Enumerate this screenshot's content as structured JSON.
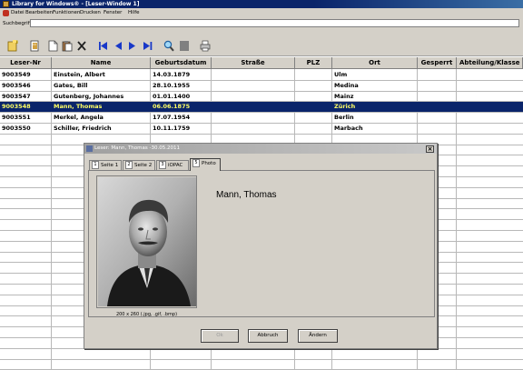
{
  "window": {
    "title": "Library for Windows® - [Leser-Window 1]"
  },
  "menu": {
    "items": [
      "Datei",
      "Bearbeiten",
      "Funktionen",
      "Drucken",
      "Fenster",
      "Hilfe"
    ]
  },
  "search": {
    "label": "Suchbegriff",
    "value": "",
    "placeholder": ""
  },
  "toolbar": {
    "buttons": [
      "new-icon",
      "copy-icon",
      "page-icon",
      "paste-icon",
      "delete-icon",
      "first-record-icon",
      "prev-record-icon",
      "next-record-icon",
      "last-record-icon",
      "search-icon",
      "stop-icon",
      "print-icon"
    ]
  },
  "grid": {
    "columns": [
      "Leser-Nr",
      "Name",
      "Geburtsdatum",
      "Straße",
      "PLZ",
      "Ort",
      "Gesperrt",
      "Abteilung/Klasse"
    ],
    "rows": [
      [
        "9003549",
        "Einstein, Albert",
        "14.03.1879",
        "",
        "",
        "Ulm",
        "",
        ""
      ],
      [
        "9003546",
        "Gates, Bill",
        "28.10.1955",
        "",
        "",
        "Medina",
        "",
        ""
      ],
      [
        "9003547",
        "Gutenberg, Johannes",
        "01.01.1400",
        "",
        "",
        "Mainz",
        "",
        ""
      ],
      [
        "9003548",
        "Mann, Thomas",
        "06.06.1875",
        "",
        "",
        "Zürich",
        "",
        ""
      ],
      [
        "9003551",
        "Merkel, Angela",
        "17.07.1954",
        "",
        "",
        "Berlin",
        "",
        ""
      ],
      [
        "9003550",
        "Schiller, Friedrich",
        "10.11.1759",
        "",
        "",
        "Marbach",
        "",
        ""
      ]
    ],
    "selected_row": 3
  },
  "dialog": {
    "title": "Leser: Mann, Thomas -30.05.2011",
    "close_label": "×",
    "tabs": [
      {
        "num": "1",
        "label": "Seite 1"
      },
      {
        "num": "2",
        "label": "Seite 2"
      },
      {
        "num": "3",
        "label": "iOPAC"
      },
      {
        "num": "5",
        "label": "Photo"
      }
    ],
    "active_tab": 3,
    "person_name": "Mann, Thomas",
    "photo_caption": "200 x 260 (.jpg, .gif, .bmp)",
    "buttons": {
      "ok": "Ok",
      "cancel": "Abbruch",
      "change": "Ändern"
    }
  },
  "colors": {
    "selection_bg": "#0a246a",
    "selection_text": "#ffff66",
    "chrome": "#d4d0c8"
  }
}
